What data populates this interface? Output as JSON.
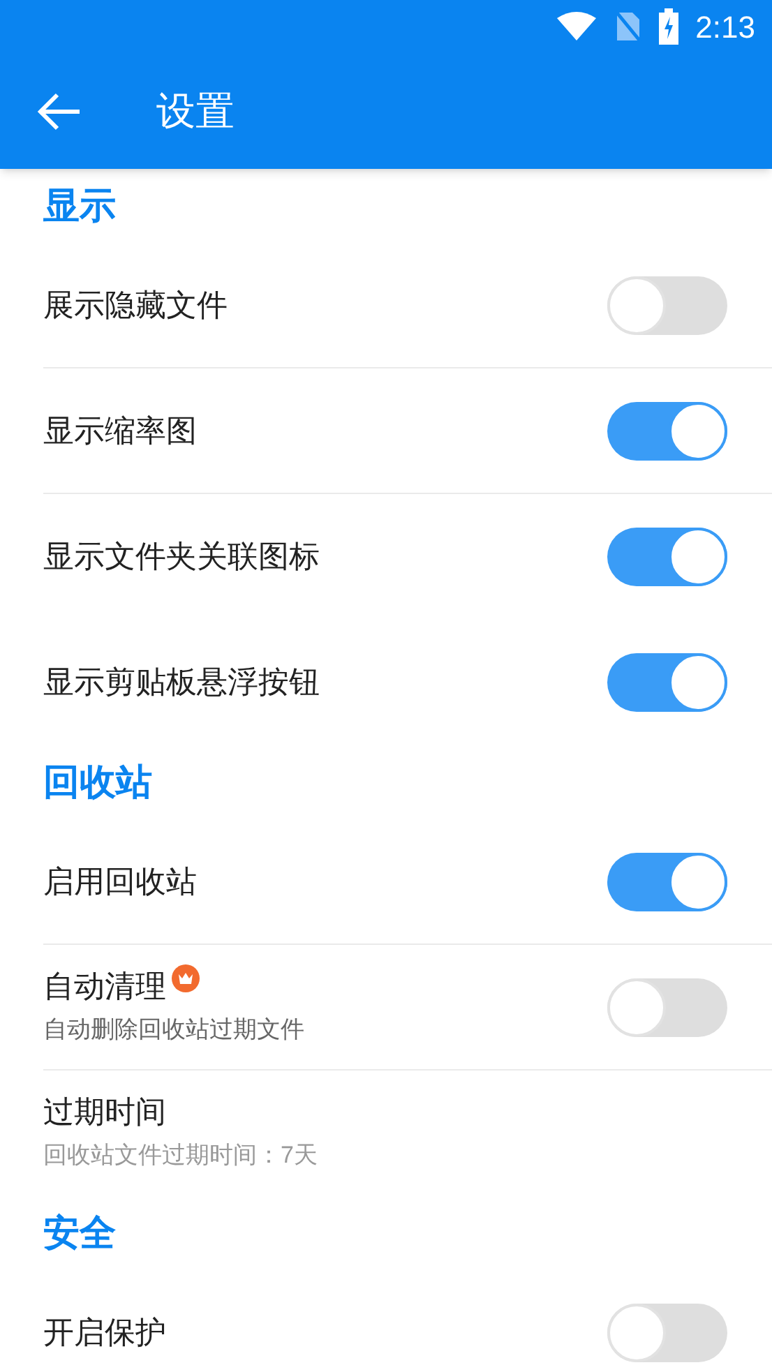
{
  "status_bar": {
    "time": "2:13"
  },
  "app_bar": {
    "title": "设置"
  },
  "sections": [
    {
      "title": "显示",
      "items": [
        {
          "kind": "switch",
          "title": "展示隐藏文件",
          "on": false,
          "divider": true,
          "premium": false
        },
        {
          "kind": "switch",
          "title": "显示缩率图",
          "on": true,
          "divider": true,
          "premium": false
        },
        {
          "kind": "switch",
          "title": "显示文件夹关联图标",
          "on": true,
          "divider": false,
          "premium": false
        },
        {
          "kind": "switch",
          "title": "显示剪贴板悬浮按钮",
          "on": true,
          "divider": false,
          "premium": false
        }
      ]
    },
    {
      "title": "回收站",
      "items": [
        {
          "kind": "switch",
          "title": "启用回收站",
          "on": true,
          "divider": true,
          "premium": false
        },
        {
          "kind": "switch",
          "title": "自动清理",
          "subtitle": "自动删除回收站过期文件",
          "on": false,
          "divider": true,
          "premium": true
        },
        {
          "kind": "text",
          "title": "过期时间",
          "subtitle": "回收站文件过期时间：7天",
          "divider": false,
          "premium": false
        }
      ]
    },
    {
      "title": "安全",
      "items": [
        {
          "kind": "switch",
          "title": "开启保护",
          "on": false,
          "premium": false
        }
      ]
    }
  ]
}
